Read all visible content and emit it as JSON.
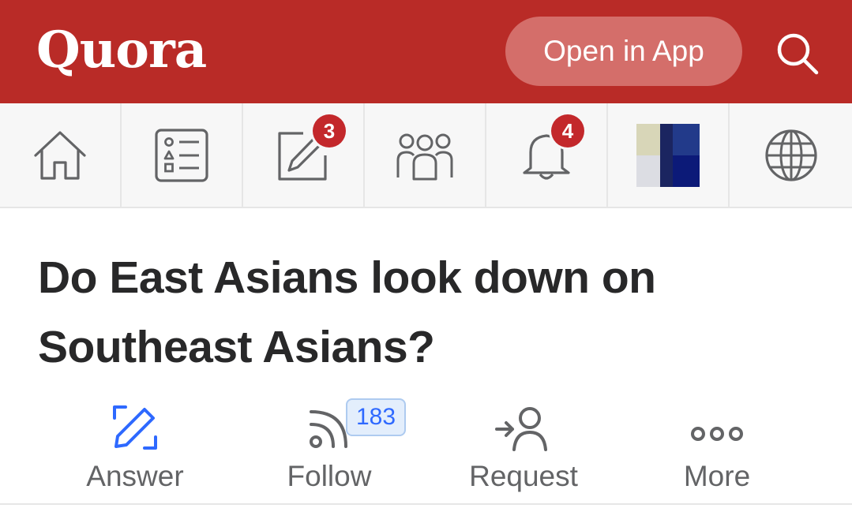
{
  "header": {
    "logo": "Quora",
    "open_in_app": "Open in App",
    "brand_color": "#b92b27"
  },
  "nav": {
    "items": [
      {
        "name": "home",
        "icon": "home-icon"
      },
      {
        "name": "following",
        "icon": "feed-list-icon"
      },
      {
        "name": "answer",
        "icon": "pencil-square-icon",
        "badge": "3"
      },
      {
        "name": "spaces",
        "icon": "people-group-icon"
      },
      {
        "name": "notifications",
        "icon": "bell-icon",
        "badge": "4"
      },
      {
        "name": "profile",
        "icon": "avatar"
      },
      {
        "name": "languages",
        "icon": "globe-icon"
      }
    ],
    "badge_color": "#c3282b"
  },
  "question": {
    "title": "Do East Asians look down on Southeast Asians?"
  },
  "actions": {
    "answer": "Answer",
    "follow": "Follow",
    "follow_count": "183",
    "request": "Request",
    "more": "More",
    "accent_color": "#2e69ff"
  }
}
